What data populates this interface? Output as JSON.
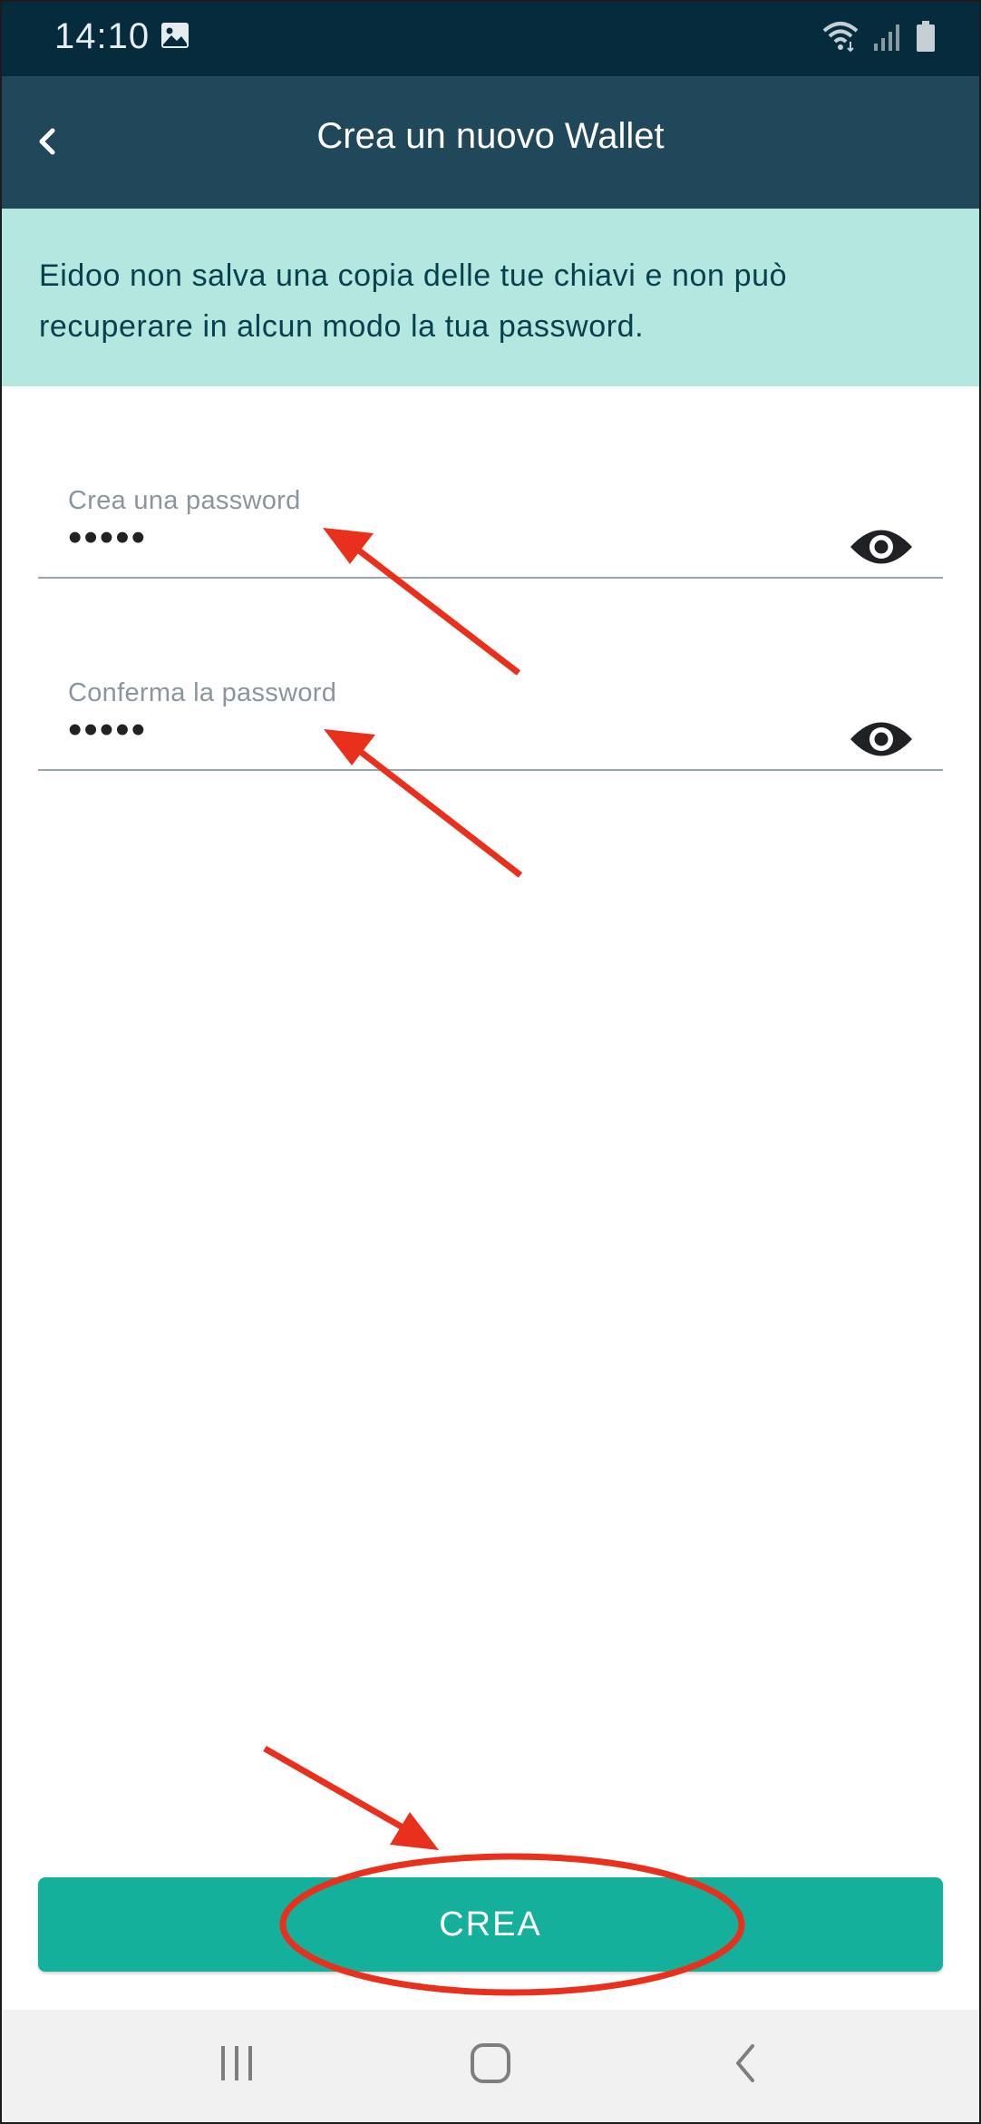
{
  "status_bar": {
    "time": "14:10"
  },
  "app_bar": {
    "title": "Crea un nuovo Wallet"
  },
  "info_banner": {
    "text": "Eidoo non salva una copia delle tue chiavi e non può recuperare in alcun modo la tua password."
  },
  "fields": [
    {
      "label": "Crea una password",
      "value": "•••••"
    },
    {
      "label": "Conferma la password",
      "value": "•••••"
    }
  ],
  "primary_button": {
    "label": "CREA"
  },
  "colors": {
    "status_bar": "#062b3c",
    "app_bar": "#21485a",
    "banner": "#b4e7e0",
    "banner_text": "#07414f",
    "button": "#14b09b",
    "annotation": "#e8301c"
  },
  "icons": [
    "image-icon",
    "wifi-icon",
    "signal-icon",
    "battery-icon",
    "back-arrow-icon",
    "eye-icon",
    "recents-icon",
    "home-icon",
    "nav-back-icon"
  ]
}
